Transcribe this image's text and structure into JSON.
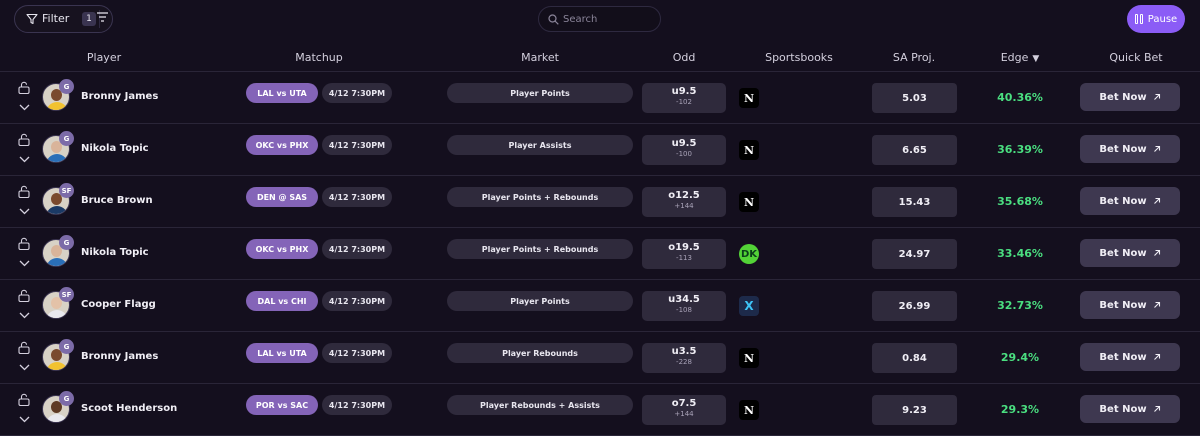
{
  "toolbar": {
    "filter_label": "Filter",
    "filter_count": "1",
    "search_placeholder": "Search",
    "search_value": "",
    "pause_label": "Pause",
    "accent_color": "#8b5cf6"
  },
  "table": {
    "columns": {
      "player": "Player",
      "matchup": "Matchup",
      "market": "Market",
      "odd": "Odd",
      "sportsbooks": "Sportsbooks",
      "sa_proj": "SA Proj.",
      "edge": "Edge",
      "quick_bet": "Quick Bet"
    },
    "edge_sort_indicator": "▼",
    "edge_color": "#4ade80",
    "rows": [
      {
        "position": "G",
        "player": "Bronny James",
        "matchup": "LAL vs UTA",
        "time": "4/12 7:30PM",
        "market": "Player Points",
        "odd_line": "u9.5",
        "odd_price": "-102",
        "book": "N",
        "book_type": "n",
        "proj": "5.03",
        "edge": "40.36%",
        "bet_label": "Bet Now",
        "avatar_skin": "#7a4a2e",
        "avatar_shirt": "#f2c230"
      },
      {
        "position": "G",
        "player": "Nikola Topic",
        "matchup": "OKC vs PHX",
        "time": "4/12 7:30PM",
        "market": "Player Assists",
        "odd_line": "u9.5",
        "odd_price": "-100",
        "book": "N",
        "book_type": "n",
        "proj": "6.65",
        "edge": "36.39%",
        "bet_label": "Bet Now",
        "avatar_skin": "#d9b49a",
        "avatar_shirt": "#2a6fb8"
      },
      {
        "position": "SF",
        "player": "Bruce Brown",
        "matchup": "DEN @ SAS",
        "time": "4/12 7:30PM",
        "market": "Player Points + Rebounds",
        "odd_line": "o12.5",
        "odd_price": "+144",
        "book": "N",
        "book_type": "n",
        "proj": "15.43",
        "edge": "35.68%",
        "bet_label": "Bet Now",
        "avatar_skin": "#7a4a2e",
        "avatar_shirt": "#1b3a66"
      },
      {
        "position": "G",
        "player": "Nikola Topic",
        "matchup": "OKC vs PHX",
        "time": "4/12 7:30PM",
        "market": "Player Points + Rebounds",
        "odd_line": "o19.5",
        "odd_price": "-113",
        "book": "DK",
        "book_type": "dk",
        "proj": "24.97",
        "edge": "33.46%",
        "bet_label": "Bet Now",
        "avatar_skin": "#d9b49a",
        "avatar_shirt": "#2a6fb8"
      },
      {
        "position": "SF",
        "player": "Cooper Flagg",
        "matchup": "DAL vs CHI",
        "time": "4/12 7:30PM",
        "market": "Player Points",
        "odd_line": "u34.5",
        "odd_price": "-108",
        "book": "X",
        "book_type": "px",
        "proj": "26.99",
        "edge": "32.73%",
        "bet_label": "Bet Now",
        "avatar_skin": "#e3c2a8",
        "avatar_shirt": "#e9e9ee"
      },
      {
        "position": "G",
        "player": "Bronny James",
        "matchup": "LAL vs UTA",
        "time": "4/12 7:30PM",
        "market": "Player Rebounds",
        "odd_line": "u3.5",
        "odd_price": "-228",
        "book": "N",
        "book_type": "n",
        "proj": "0.84",
        "edge": "29.4%",
        "bet_label": "Bet Now",
        "avatar_skin": "#7a4a2e",
        "avatar_shirt": "#f2c230"
      },
      {
        "position": "G",
        "player": "Scoot Henderson",
        "matchup": "POR vs SAC",
        "time": "4/12 7:30PM",
        "market": "Player Rebounds + Assists",
        "odd_line": "o7.5",
        "odd_price": "+144",
        "book": "N",
        "book_type": "n",
        "proj": "9.23",
        "edge": "29.3%",
        "bet_label": "Bet Now",
        "avatar_skin": "#5e3a24",
        "avatar_shirt": "#e9e9ee"
      }
    ]
  }
}
